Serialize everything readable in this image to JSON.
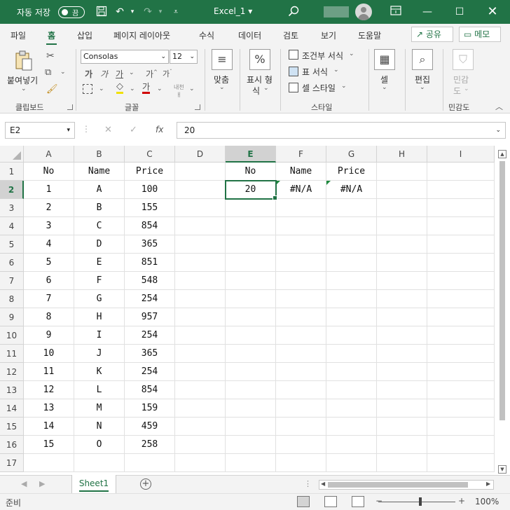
{
  "titlebar": {
    "autosave_label": "자동 저장",
    "autosave_state": "끔",
    "doc_title": "Excel_1 ▾"
  },
  "tabs": [
    "파일",
    "홈",
    "삽입",
    "페이지 레이아웃",
    "수식",
    "데이터",
    "검토",
    "보기",
    "도움말"
  ],
  "active_tab": "홈",
  "share_label": "공유",
  "memo_label": "메모",
  "ribbon": {
    "paste_label": "붙여넣기",
    "clipboard_group": "클립보드",
    "font_name": "Consolas",
    "font_size": "12",
    "font_group": "글꼴",
    "align_label": "맞춤",
    "number_label_1": "표시 형",
    "number_label_2": "식",
    "cond_format": "조건부 서식",
    "table_format": "표 서식",
    "cell_style": "셀 스타일",
    "style_group": "스타일",
    "cells_label": "셀",
    "edit_label": "편집",
    "sensitivity_label_1": "민감",
    "sensitivity_label_2": "도",
    "sensitivity_group": "민감도"
  },
  "formula_bar": {
    "name_box": "E2",
    "formula": "20"
  },
  "columns": [
    "A",
    "B",
    "C",
    "D",
    "E",
    "F",
    "G",
    "H",
    "I"
  ],
  "rows": [
    "1",
    "2",
    "3",
    "4",
    "5",
    "6",
    "7",
    "8",
    "9",
    "10",
    "11",
    "12",
    "13",
    "14",
    "15",
    "16",
    "17"
  ],
  "table": {
    "headers": [
      "No",
      "Name",
      "Price"
    ],
    "data": [
      [
        "1",
        "A",
        "100"
      ],
      [
        "2",
        "B",
        "155"
      ],
      [
        "3",
        "C",
        "854"
      ],
      [
        "4",
        "D",
        "365"
      ],
      [
        "5",
        "E",
        "851"
      ],
      [
        "6",
        "F",
        "548"
      ],
      [
        "7",
        "G",
        "254"
      ],
      [
        "8",
        "H",
        "957"
      ],
      [
        "9",
        "I",
        "254"
      ],
      [
        "10",
        "J",
        "365"
      ],
      [
        "11",
        "K",
        "254"
      ],
      [
        "12",
        "L",
        "854"
      ],
      [
        "13",
        "M",
        "159"
      ],
      [
        "14",
        "N",
        "459"
      ],
      [
        "15",
        "O",
        "258"
      ]
    ]
  },
  "lookup": {
    "headers": [
      "No",
      "Name",
      "Price"
    ],
    "values": [
      "20",
      "#N/A",
      "#N/A"
    ]
  },
  "sheet_tab": "Sheet1",
  "status": {
    "text": "준비",
    "zoom": "100%"
  },
  "colors": {
    "accent": "#217346"
  }
}
